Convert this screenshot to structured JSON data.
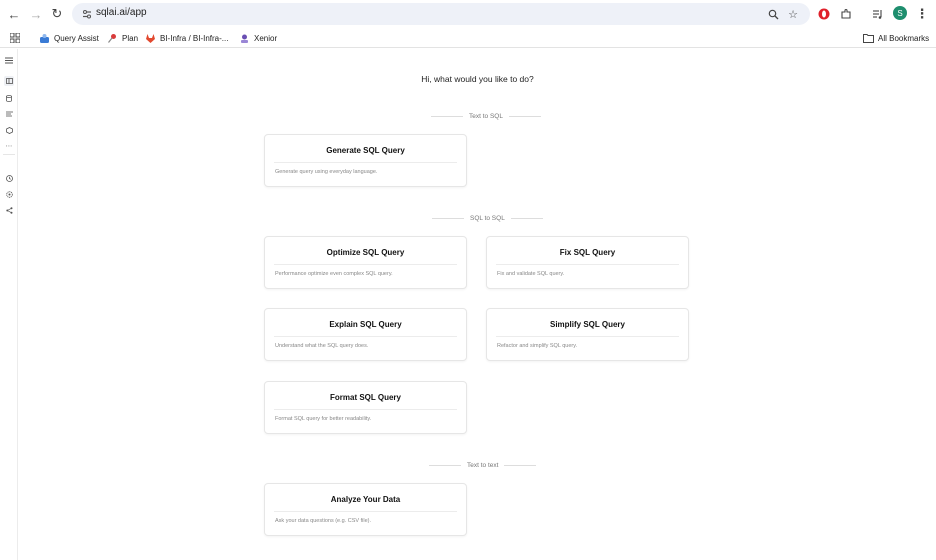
{
  "browser": {
    "url": "sqlai.ai/app",
    "avatar_letter": "S",
    "brand_color": "#1e8e6e"
  },
  "bookmarks": {
    "items": [
      {
        "label": "Query Assist",
        "icon": "query-assist-icon"
      },
      {
        "label": "Plan",
        "icon": "pin-icon"
      },
      {
        "label": "BI-Infra / BI-Infra-...",
        "icon": "gitlab-icon"
      },
      {
        "label": "Xenior",
        "icon": "xenior-icon"
      }
    ],
    "all_bookmarks": "All Bookmarks"
  },
  "main": {
    "greeting": "Hi, what would you like to do?",
    "sections": [
      {
        "label": "Text to SQL"
      },
      {
        "label": "SQL to SQL"
      },
      {
        "label": "Text to text"
      }
    ],
    "cards": {
      "generate": {
        "title": "Generate SQL Query",
        "desc": "Generate query using everyday language."
      },
      "optimize": {
        "title": "Optimize SQL Query",
        "desc": "Performance optimize even complex SQL query."
      },
      "fix": {
        "title": "Fix SQL Query",
        "desc": "Fix and validate SQL query."
      },
      "explain": {
        "title": "Explain SQL Query",
        "desc": "Understand what the SQL query does."
      },
      "simplify": {
        "title": "Simplify SQL Query",
        "desc": "Refactor and simplify SQL query."
      },
      "format": {
        "title": "Format SQL Query",
        "desc": "Format SQL query for better readability."
      },
      "analyze": {
        "title": "Analyze Your Data",
        "desc": "Ask your data questions (e.g. CSV file)."
      }
    }
  }
}
